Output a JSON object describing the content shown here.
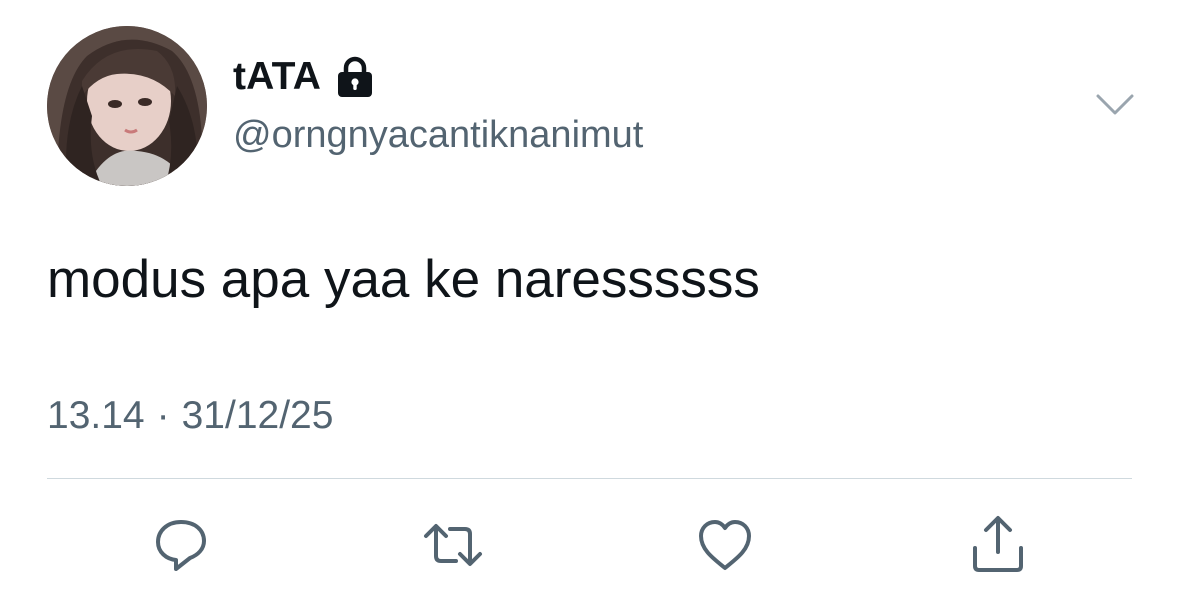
{
  "author": {
    "display_name": "tATA",
    "handle": "@orngnyacantiknanimut",
    "protected_icon": "lock-icon",
    "avatar": "profile-photo"
  },
  "tweet": {
    "text": "modus apa yaa ke naressssss",
    "time": "13.14",
    "separator": "·",
    "date": "31/12/25"
  },
  "actions": [
    {
      "name": "reply",
      "icon": "speech-bubble-icon"
    },
    {
      "name": "retweet",
      "icon": "retweet-arrows-icon"
    },
    {
      "name": "like",
      "icon": "heart-icon"
    },
    {
      "name": "share",
      "icon": "share-upload-icon"
    }
  ],
  "menu_icon": "chevron-down-icon",
  "colors": {
    "text_primary": "#0f1419",
    "text_secondary": "#536471",
    "divider": "#cfd9de",
    "icon": "#536471"
  }
}
